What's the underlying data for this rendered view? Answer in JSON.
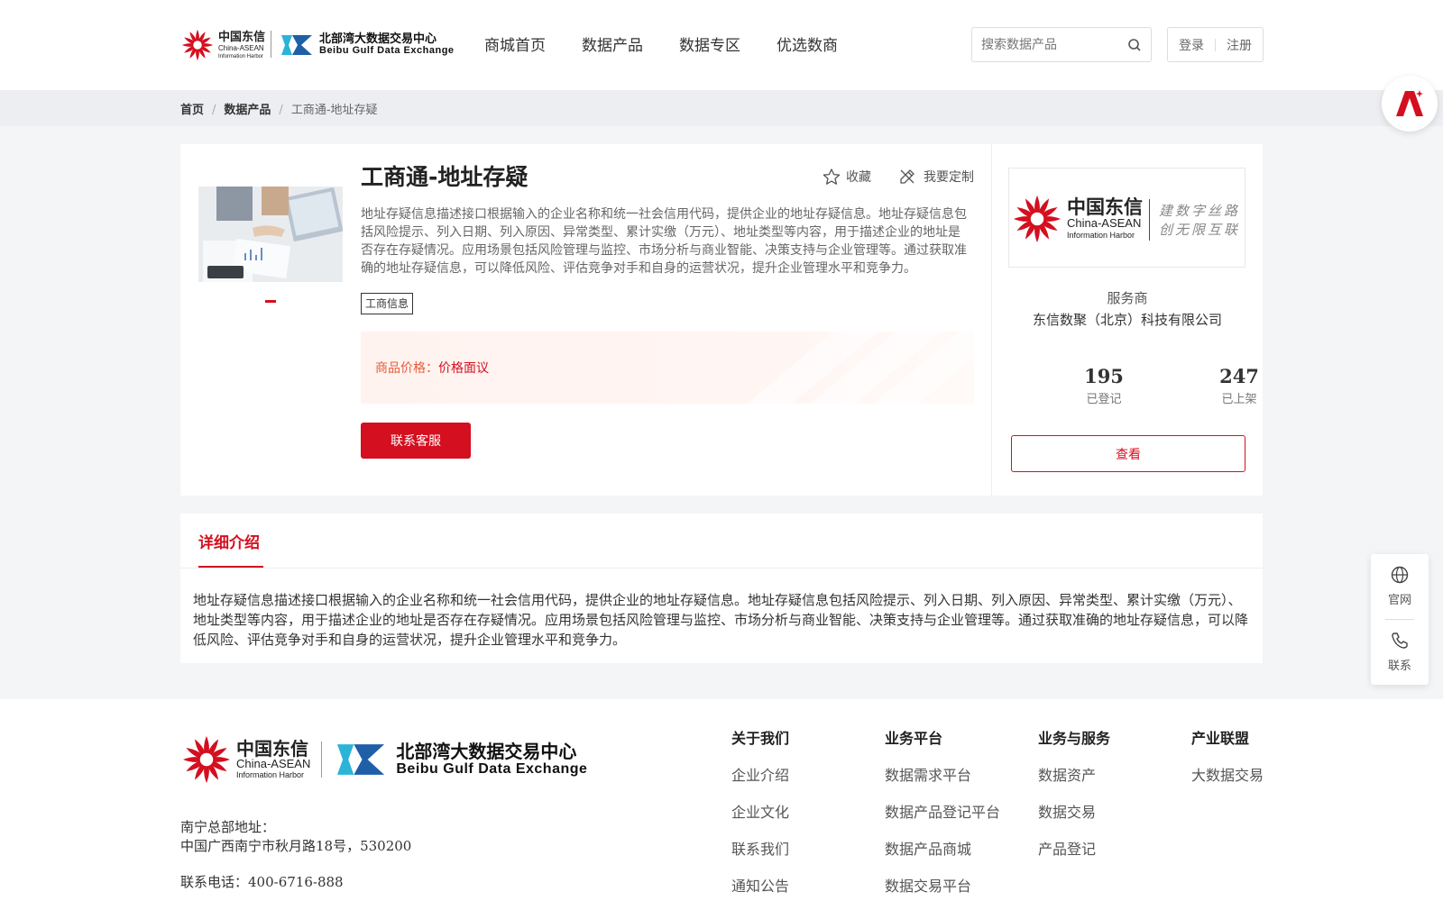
{
  "header": {
    "logo_cdx": {
      "cn": "中国东信",
      "en1": "China-ASEAN",
      "en2": "Information Harbor"
    },
    "logo_bb": {
      "cn": "北部湾大数据交易中心",
      "en": "Beibu Gulf Data Exchange"
    },
    "nav": [
      "商城首页",
      "数据产品",
      "数据专区",
      "优选数商"
    ],
    "search_placeholder": "搜索数据产品",
    "login": "登录",
    "register": "注册"
  },
  "breadcrumb": {
    "home": "首页",
    "category": "数据产品",
    "current": "工商通-地址存疑",
    "sep": "/"
  },
  "product": {
    "title": "工商通-地址存疑",
    "favorite": "收藏",
    "customize": "我要定制",
    "description": "地址存疑信息描述接口根据输入的企业名称和统一社会信用代码，提供企业的地址存疑信息。地址存疑信息包括风险提示、列入日期、列入原因、异常类型、累计实缴（万元）、地址类型等内容，用于描述企业的地址是否存在存疑情况。应用场景包括风险管理与监控、市场分析与商业智能、决策支持与企业管理等。通过获取准确的地址存疑信息，可以降低风险、评估竞争对手和自身的运营状况，提升企业管理水平和竞争力。",
    "tag": "工商信息",
    "price_label": "商品价格：",
    "price_value": "价格面议",
    "contact_button": "联系客服"
  },
  "provider": {
    "logo": {
      "cn": "中国东信",
      "en1": "China-ASEAN",
      "en2": "Information Harbor",
      "slogan1": "建数字丝路",
      "slogan2": "创无限互联"
    },
    "title": "服务商",
    "name": "东信数聚（北京）科技有限公司",
    "stats": [
      {
        "value": "195",
        "label": "已登记"
      },
      {
        "value": "247",
        "label": "已上架"
      }
    ],
    "view_button": "查看"
  },
  "detail": {
    "tab": "详细介绍",
    "text": "地址存疑信息描述接口根据输入的企业名称和统一社会信用代码，提供企业的地址存疑信息。地址存疑信息包括风险提示、列入日期、列入原因、异常类型、累计实缴（万元）、地址类型等内容，用于描述企业的地址是否存在存疑情况。应用场景包括风险管理与监控、市场分析与商业智能、决策支持与企业管理等。通过获取准确的地址存疑信息，可以降低风险、评估竞争对手和自身的运营状况，提升企业管理水平和竞争力。"
  },
  "floating": {
    "website": "官网",
    "contact": "联系"
  },
  "footer": {
    "address_label": "南宁总部地址：",
    "address": "中国广西南宁市秋月路18号，530200",
    "phone": "联系电话：400-6716-888",
    "columns": [
      {
        "title": "关于我们",
        "items": [
          "企业介绍",
          "企业文化",
          "联系我们",
          "通知公告"
        ]
      },
      {
        "title": "业务平台",
        "items": [
          "数据需求平台",
          "数据产品登记平台",
          "数据产品商城",
          "数据交易平台"
        ]
      },
      {
        "title": "业务与服务",
        "items": [
          "数据资产",
          "数据交易",
          "产品登记"
        ]
      },
      {
        "title": "产业联盟",
        "items": [
          "大数据交易"
        ]
      }
    ]
  },
  "colors": {
    "brand_red": "#d40f1f",
    "brand_blue": "#1f5fa8",
    "price_orange": "#e55c3a"
  },
  "icons": [
    "search-icon",
    "star-icon",
    "customize-icon",
    "ai-assistant-icon",
    "globe-icon",
    "phone-icon"
  ]
}
